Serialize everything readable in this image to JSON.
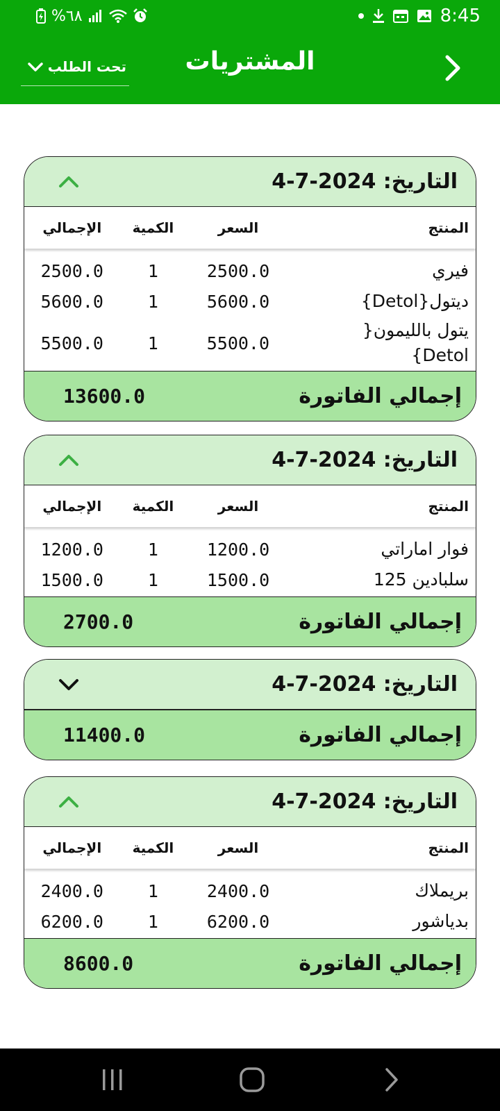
{
  "status_bar": {
    "battery_text": "%٦٨",
    "time": "8:45"
  },
  "app_bar": {
    "title": "المشتريات",
    "filter_value": "تحت الطلب"
  },
  "table_headers": {
    "product": "المنتج",
    "price": "السعر",
    "qty": "الكمية",
    "total": "الإجمالي"
  },
  "invoice_total_label": "إجمالي الفاتورة",
  "invoices": [
    {
      "date_label": "التاريخ: 2024-7-4",
      "expanded": true,
      "rows": [
        {
          "product": "فيري",
          "price": "2500.0",
          "qty": "1",
          "total": "2500.0"
        },
        {
          "product": "ديتول{Detol}",
          "price": "5600.0",
          "qty": "1",
          "total": "5600.0"
        },
        {
          "product": "يتول بالليمون{ Detol}",
          "price": "5500.0",
          "qty": "1",
          "total": "5500.0"
        }
      ],
      "total": "13600.0"
    },
    {
      "date_label": "التاريخ: 2024-7-4",
      "expanded": true,
      "rows": [
        {
          "product": "فوار اماراتي",
          "price": "1200.0",
          "qty": "1",
          "total": "1200.0"
        },
        {
          "product": "سلبادين 125",
          "price": "1500.0",
          "qty": "1",
          "total": "1500.0"
        }
      ],
      "total": "2700.0"
    },
    {
      "date_label": "التاريخ: 2024-7-4",
      "expanded": false,
      "rows": [],
      "total": "11400.0"
    },
    {
      "date_label": "التاريخ: 2024-7-4",
      "expanded": true,
      "rows": [
        {
          "product": "بريملاك",
          "price": "2400.0",
          "qty": "1",
          "total": "2400.0"
        },
        {
          "product": "بدياشور",
          "price": "6200.0",
          "qty": "1",
          "total": "6200.0"
        }
      ],
      "total": "8600.0"
    }
  ],
  "colors": {
    "brand_green": "#0aa80a",
    "header_bg": "#d2f0cf",
    "footer_bg": "#a8e4a0",
    "chevron_green": "#3cb043"
  }
}
